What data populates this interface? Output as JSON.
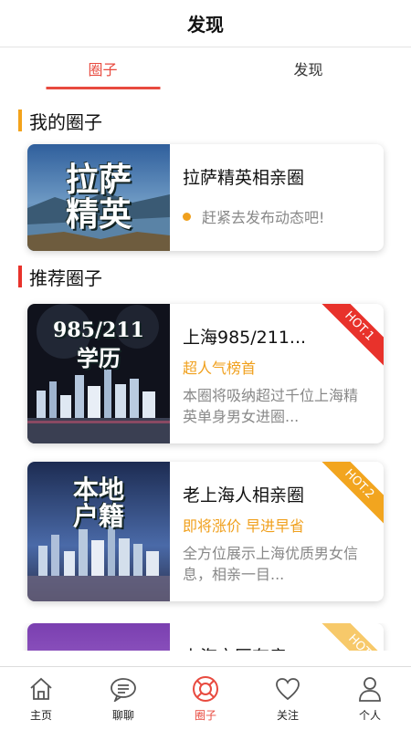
{
  "header": {
    "title": "发现"
  },
  "tabs": [
    {
      "label": "圈子",
      "active": true
    },
    {
      "label": "发现",
      "active": false
    }
  ],
  "my_circles": {
    "section_title": "我的圈子",
    "items": [
      {
        "image_text_1": "拉萨",
        "image_text_2": "精英",
        "name": "拉萨精英相亲圈",
        "hint": "赶紧去发布动态吧!"
      }
    ]
  },
  "recommended": {
    "section_title": "推荐圈子",
    "items": [
      {
        "image_text_1": "985/211",
        "image_text_2": "学历",
        "badge": "HOT.1",
        "name": "上海985/211...",
        "tag": "超人气榜首",
        "desc": "本圈将吸纳超过千位上海精英单身男女进圈..."
      },
      {
        "image_text_1": "本地",
        "image_text_2": "户籍",
        "badge": "HOT.2",
        "name": "老上海人相亲圈",
        "tag": "即将涨价 早进早省",
        "desc": "全方位展示上海优质男女信息，相亲一目..."
      },
      {
        "badge": "HOT",
        "name": "上海市区有房"
      }
    ]
  },
  "bottom_nav": [
    {
      "label": "主页",
      "icon": "home-icon",
      "active": false
    },
    {
      "label": "聊聊",
      "icon": "chat-icon",
      "active": false
    },
    {
      "label": "圈子",
      "icon": "circle-icon",
      "active": true
    },
    {
      "label": "关注",
      "icon": "heart-icon",
      "active": false
    },
    {
      "label": "个人",
      "icon": "person-icon",
      "active": false
    }
  ],
  "colors": {
    "accent": "#e84a3f",
    "orange": "#f0a01d",
    "hot1": "#e8322b",
    "hot2": "#f2a51f"
  }
}
